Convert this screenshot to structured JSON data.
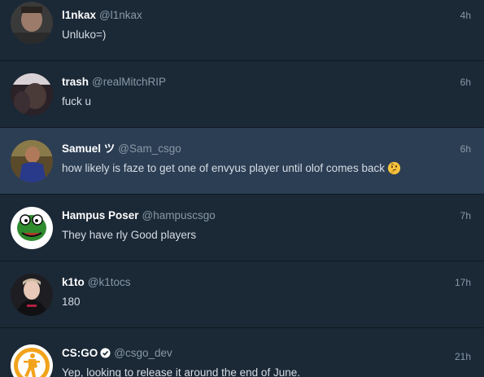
{
  "tweets": [
    {
      "name": "l1nkax",
      "handle": "@l1nkax",
      "time": "4h",
      "text": "Unluko=)"
    },
    {
      "name": "trash",
      "handle": "@realMitchRIP",
      "time": "6h",
      "text": "fuck u"
    },
    {
      "name": "Samuel ツ",
      "handle": "@Sam_csgo",
      "time": "6h",
      "text": "how likely is faze to get one of envyus player until olof comes back",
      "emoji": "thinking-face-emoji",
      "highlighted": true
    },
    {
      "name": "Hampus Poser",
      "handle": "@hampuscsgo",
      "time": "7h",
      "text": "They have rly Good players"
    },
    {
      "name": "k1to",
      "handle": "@k1tocs",
      "time": "17h",
      "text": "180"
    },
    {
      "name": "CS:GO",
      "handle": "@csgo_dev",
      "time": "21h",
      "text": "Yep, looking to release it around the end of June.",
      "verified": true
    }
  ],
  "colors": {
    "background": "#1b2836",
    "highlight": "#2c3e54",
    "name": "#ffffff",
    "secondary": "#8899a6",
    "text": "#d6dde4"
  }
}
